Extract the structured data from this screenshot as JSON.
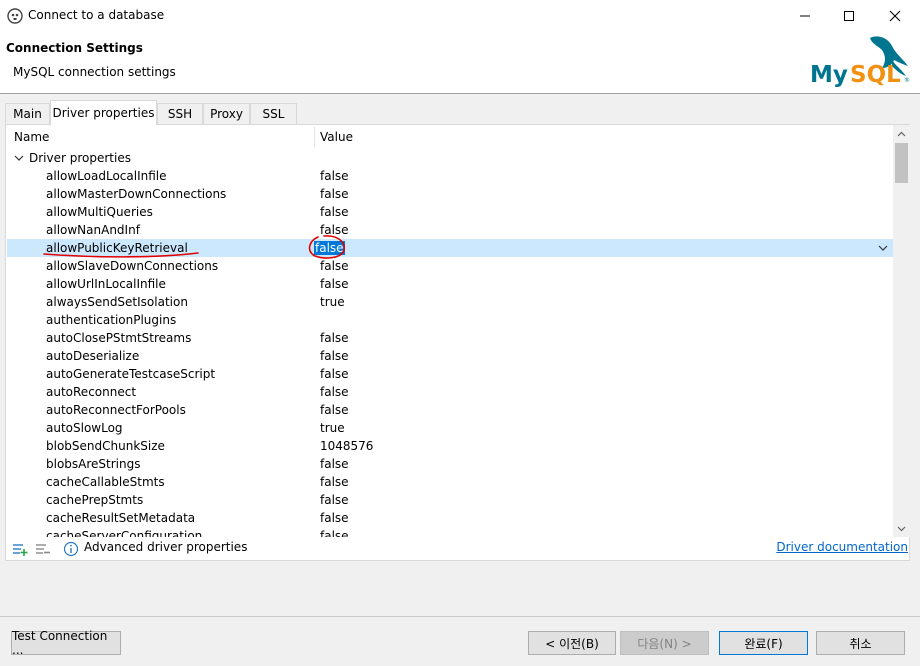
{
  "window": {
    "title": "Connect to a database",
    "controls": [
      "minimize-icon",
      "maximize-icon",
      "close-icon"
    ]
  },
  "header": {
    "title": "Connection Settings",
    "subtitle": "MySQL connection settings",
    "logo_text": "MySQL"
  },
  "tabs": [
    {
      "label": "Main",
      "active": false
    },
    {
      "label": "Driver properties",
      "active": true
    },
    {
      "label": "SSH",
      "active": false
    },
    {
      "label": "Proxy",
      "active": false
    },
    {
      "label": "SSL",
      "active": false
    }
  ],
  "table": {
    "col_name": "Name",
    "col_value": "Value",
    "group_label": "Driver properties",
    "rows": [
      {
        "name": "allowLoadLocalInfile",
        "value": "false"
      },
      {
        "name": "allowMasterDownConnections",
        "value": "false"
      },
      {
        "name": "allowMultiQueries",
        "value": "false"
      },
      {
        "name": "allowNanAndInf",
        "value": "false"
      },
      {
        "name": "allowPublicKeyRetrieval",
        "value": "false"
      },
      {
        "name": "allowSlaveDownConnections",
        "value": "false"
      },
      {
        "name": "allowUrlInLocalInfile",
        "value": "false"
      },
      {
        "name": "alwaysSendSetIsolation",
        "value": "true"
      },
      {
        "name": "authenticationPlugins",
        "value": ""
      },
      {
        "name": "autoClosePStmtStreams",
        "value": "false"
      },
      {
        "name": "autoDeserialize",
        "value": "false"
      },
      {
        "name": "autoGenerateTestcaseScript",
        "value": "false"
      },
      {
        "name": "autoReconnect",
        "value": "false"
      },
      {
        "name": "autoReconnectForPools",
        "value": "false"
      },
      {
        "name": "autoSlowLog",
        "value": "true"
      },
      {
        "name": "blobSendChunkSize",
        "value": "1048576"
      },
      {
        "name": "blobsAreStrings",
        "value": "false"
      },
      {
        "name": "cacheCallableStmts",
        "value": "false"
      },
      {
        "name": "cachePrepStmts",
        "value": "false"
      },
      {
        "name": "cacheResultSetMetadata",
        "value": "false"
      },
      {
        "name": "cacheServerConfiguration",
        "value": "false"
      }
    ]
  },
  "footer": {
    "advanced_label": "Advanced driver properties",
    "doc_link": "Driver documentation"
  },
  "buttons": {
    "test": "Test Connection ...",
    "back": "< 이전(B)",
    "next": "다음(N) >",
    "finish": "완료(F)",
    "cancel": "취소"
  },
  "colors": {
    "selection": "#cce8ff",
    "accent": "#0078d7",
    "annotation": "#e00000",
    "logo_blue": "#00758f",
    "logo_orange": "#f29111"
  }
}
